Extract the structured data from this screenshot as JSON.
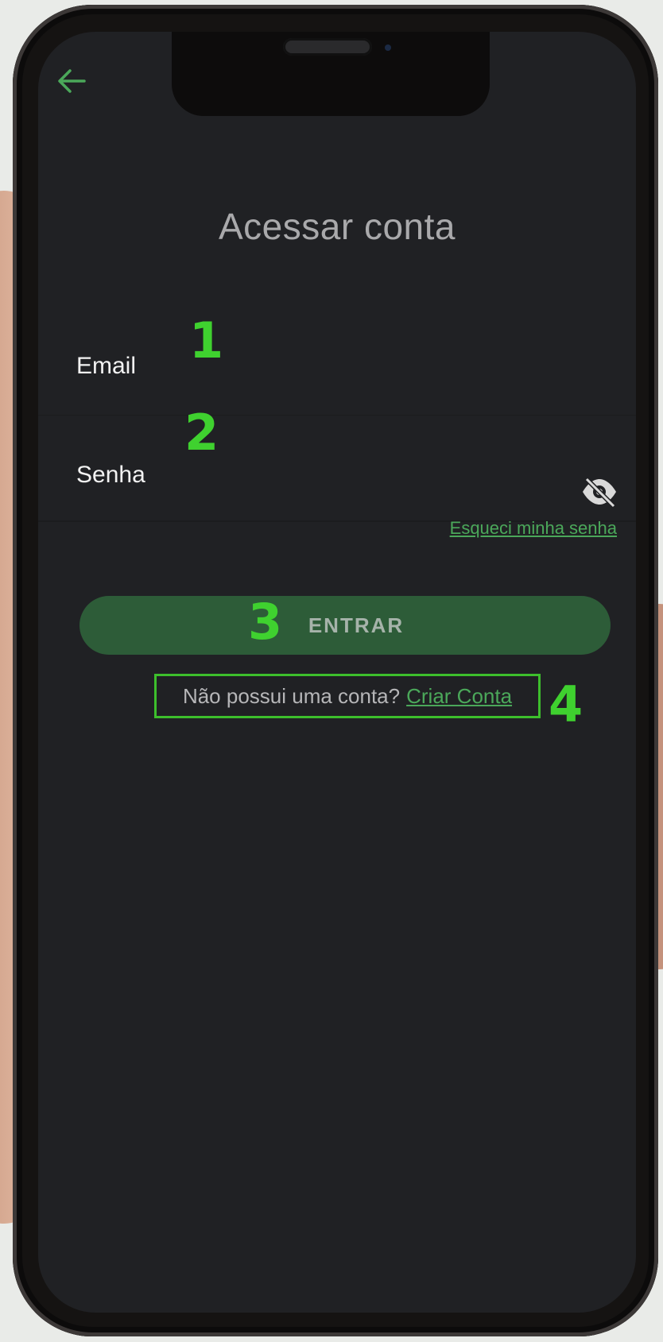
{
  "page": {
    "title": "Acessar conta"
  },
  "form": {
    "email_label": "Email",
    "password_label": "Senha",
    "forgot_link": "Esqueci minha senha",
    "submit_label": "ENTRAR",
    "signup_prompt": "Não possui uma conta?",
    "signup_link": "Criar Conta"
  },
  "annotations": {
    "markers": [
      "1",
      "2",
      "3",
      "4"
    ]
  },
  "icons": {
    "back": "arrow-left-icon",
    "password_visibility": "eye-off-icon"
  },
  "colors": {
    "screen_background": "#202124",
    "accent_green": "#4ba85a",
    "button_green": "#2d5c38",
    "annotation_green": "#3fd12f"
  }
}
